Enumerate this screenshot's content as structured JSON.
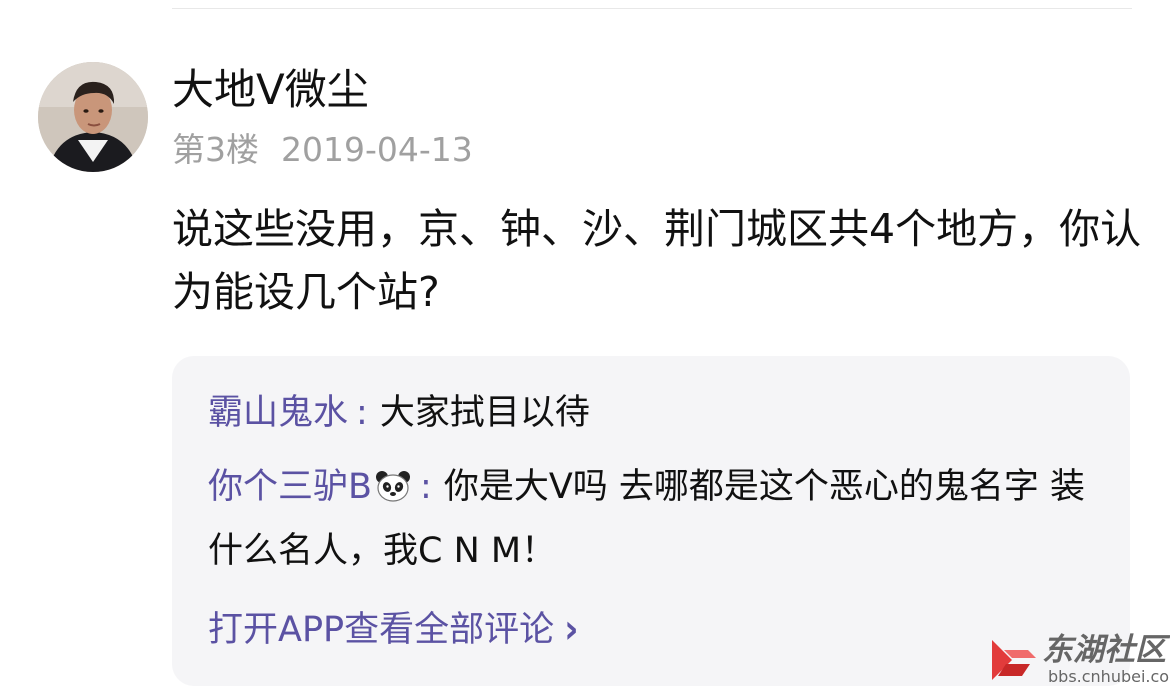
{
  "post": {
    "author": "大地V微尘",
    "floor": "第3楼",
    "date": "2019-04-13",
    "content": "说这些没用，京、钟、沙、荆门城区共4个地方，你认为能设几个站?"
  },
  "replies": [
    {
      "name": "霸山鬼水",
      "separator": ":",
      "text": "大家拭目以待"
    },
    {
      "name": "你个三驴B",
      "separator": ":",
      "text": "你是大V吗 去哪都是这个恶心的鬼名字 装什么名人，我C N M！"
    }
  ],
  "open_app": {
    "label": "打开APP查看全部评论",
    "chevron": "›"
  },
  "watermark": {
    "brand": "东湖社区",
    "url": "bbs.cnhubei.com"
  },
  "colors": {
    "reply_name": "#5b52a3",
    "meta": "#a0a0a0",
    "reply_bg": "#f5f5f7",
    "watermark_logo": "#e23b3b"
  },
  "icons": {
    "avatar": "user-avatar-photo",
    "panda": "panda-emoji",
    "chevron": "chevron-right-icon",
    "logo": "dong-hu-logo"
  }
}
